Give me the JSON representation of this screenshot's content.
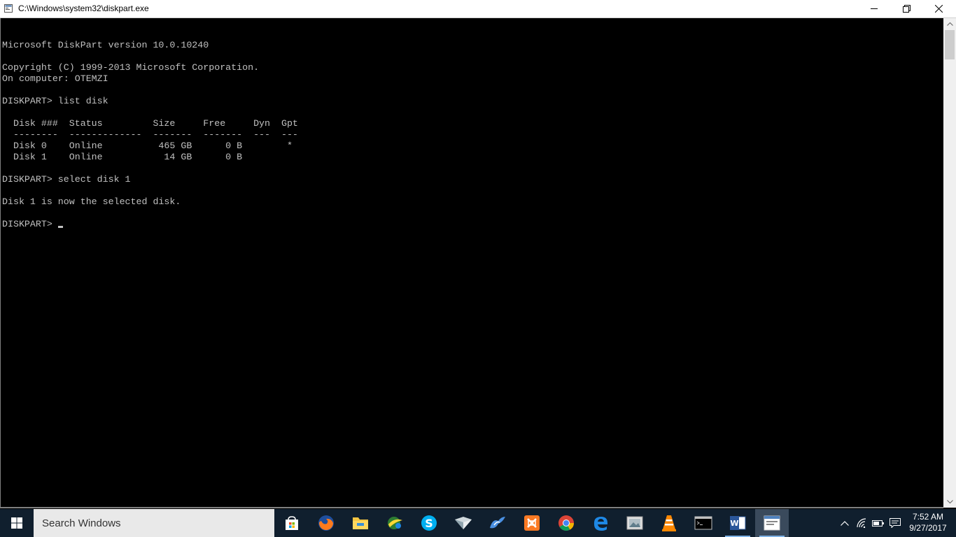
{
  "window": {
    "title": "C:\\Windows\\system32\\diskpart.exe"
  },
  "console": {
    "lines": [
      "",
      "Microsoft DiskPart version 10.0.10240",
      "",
      "Copyright (C) 1999-2013 Microsoft Corporation.",
      "On computer: OTEMZI",
      "",
      "DISKPART> list disk",
      "",
      "  Disk ###  Status         Size     Free     Dyn  Gpt",
      "  --------  -------------  -------  -------  ---  ---",
      "  Disk 0    Online          465 GB      0 B        *",
      "  Disk 1    Online           14 GB      0 B",
      "",
      "DISKPART> select disk 1",
      "",
      "Disk 1 is now the selected disk.",
      ""
    ],
    "prompt": "DISKPART> "
  },
  "taskbar": {
    "search_placeholder": "Search Windows",
    "time": "7:52 AM",
    "date": "9/27/2017",
    "icons": [
      "store-icon",
      "firefox-icon",
      "file-explorer-icon",
      "kaspersky-icon",
      "skype-icon",
      "book-icon",
      "bird-icon",
      "xampp-icon",
      "chrome-icon",
      "edge-icon",
      "photo-viewer-icon",
      "vlc-icon",
      "cmd-icon",
      "word-icon",
      "diskpart-window-icon"
    ]
  },
  "colors": {
    "console_bg": "#000000",
    "console_text": "#c0c0c0",
    "taskbar_bg": "#101f2e"
  }
}
